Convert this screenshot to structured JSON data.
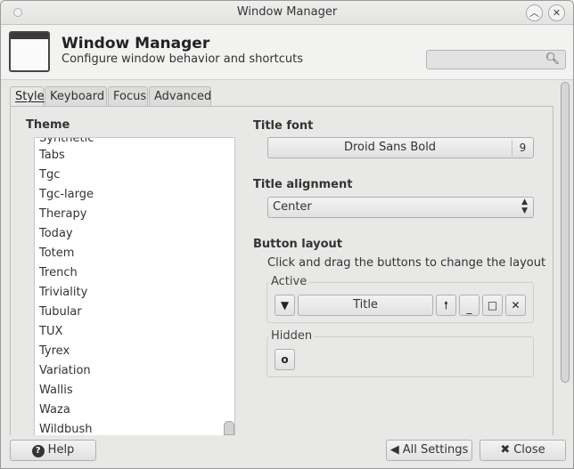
{
  "window": {
    "title": "Window Manager"
  },
  "header": {
    "title": "Window Manager",
    "subtitle": "Configure window behavior and shortcuts",
    "search_placeholder": ""
  },
  "tabs": [
    {
      "label": "Style",
      "active": true
    },
    {
      "label": "Keyboard",
      "active": false
    },
    {
      "label": "Focus",
      "active": false
    },
    {
      "label": "Advanced",
      "active": false
    }
  ],
  "style": {
    "theme_label": "Theme",
    "themes": [
      "Synthetic",
      "Tabs",
      "Tgc",
      "Tgc-large",
      "Therapy",
      "Today",
      "Totem",
      "Trench",
      "Triviality",
      "Tubular",
      "TUX",
      "Tyrex",
      "Variation",
      "Wallis",
      "Waza",
      "Wildbush"
    ],
    "title_font_label": "Title font",
    "title_font_name": "Droid Sans Bold",
    "title_font_size": "9",
    "title_alignment_label": "Title alignment",
    "title_alignment_value": "Center",
    "button_layout_label": "Button layout",
    "button_layout_hint": "Click and drag the buttons to change the layout",
    "active_label": "Active",
    "active_title_button": "Title",
    "hidden_label": "Hidden"
  },
  "footer": {
    "help_label": "Help",
    "all_settings_label": "All Settings",
    "close_label": "Close"
  }
}
